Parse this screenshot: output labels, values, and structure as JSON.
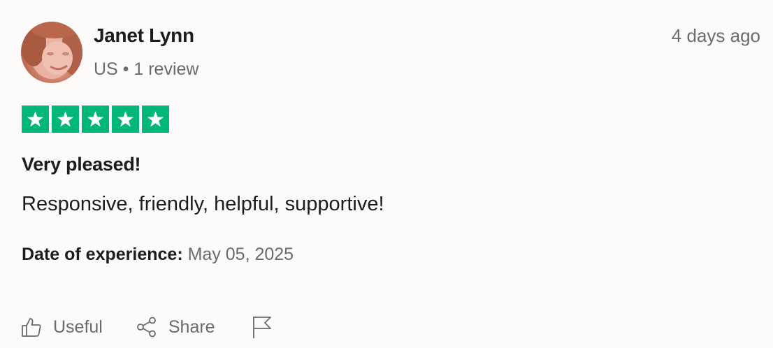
{
  "reviewer": {
    "name": "Janet Lynn",
    "meta": "US • 1 review",
    "avatar_icon": "avatar-photo"
  },
  "review": {
    "posted": "4 days ago",
    "rating": 5,
    "rating_max": 5,
    "star_color": "#00b67a",
    "title": "Very pleased!",
    "text": "Responsive, friendly, helpful, supportive!",
    "experience_label": "Date of experience:",
    "experience_date": "May 05, 2025"
  },
  "actions": {
    "useful_label": "Useful",
    "useful_icon": "thumbs-up-icon",
    "share_label": "Share",
    "share_icon": "share-icon",
    "report_icon": "flag-icon"
  }
}
